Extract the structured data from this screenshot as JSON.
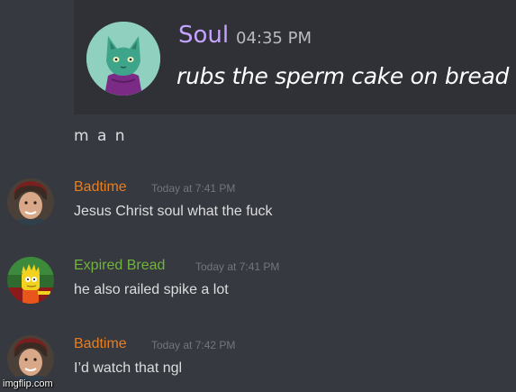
{
  "embed": {
    "username": "Soul",
    "timestamp": "04:35 PM",
    "message": "rubs the sperm cake on bread"
  },
  "standalone_message": "m a n",
  "messages": [
    {
      "username": "Badtime",
      "timestamp": "Today at 7:41 PM",
      "text": "Jesus Christ soul what the fuck",
      "name_color": "#e67e22"
    },
    {
      "username": "Expired Bread",
      "timestamp": "Today at 7:41 PM",
      "text": "he also railed spike a lot",
      "name_color": "#71b33c"
    },
    {
      "username": "Badtime",
      "timestamp": "Today at 7:42 PM",
      "text": "I’d watch that ngl",
      "name_color": "#e67e22"
    }
  ],
  "watermark": "imgflip.com",
  "colors": {
    "background": "#36393f",
    "embed_background": "#2f3136",
    "soul_name": "#c6a3ff"
  }
}
